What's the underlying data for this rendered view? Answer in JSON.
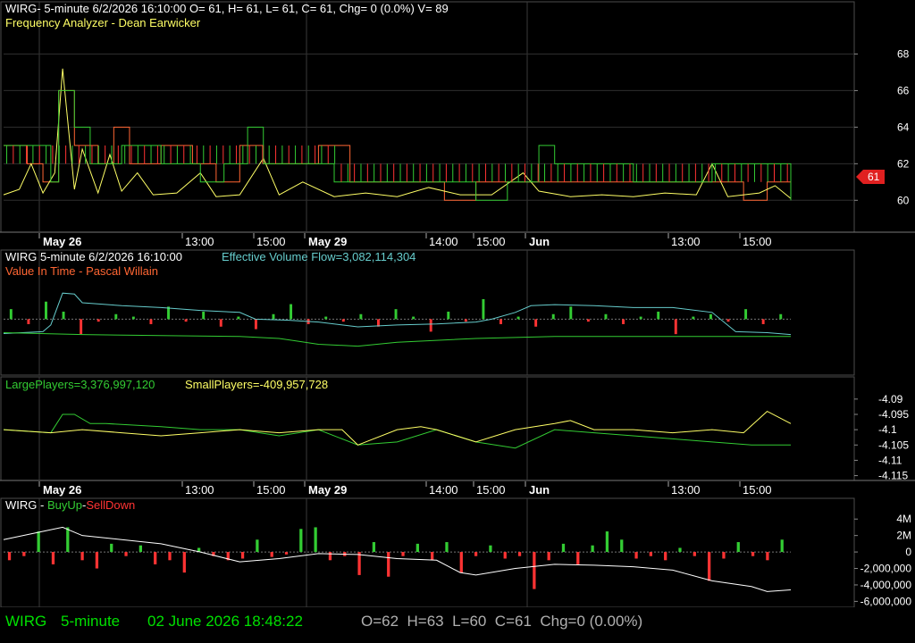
{
  "colors": {
    "background": "#000000",
    "border": "#4d4d4d",
    "grid": "#2e2e2e",
    "text": "#ffffff",
    "orange": "#ff6633",
    "yellow": "#ffff66",
    "green": "#33cc33",
    "red": "#ff3333",
    "teal": "#66cccc",
    "footer_green": "#00e000",
    "footer_grey": "#b0b0b0"
  },
  "header": {
    "line1": "WIRG- 5-minute 6/2/2026 16:10:00 O= 61, H= 61, L= 61, C= 61, Chg= 0 (0.0%) V= 89",
    "line2": "Frequency Analyzer - Dean Earwicker"
  },
  "time_axis": {
    "date_labels": [
      "May 26",
      "May 29",
      "Jun"
    ],
    "time_labels": [
      "13:00",
      "15:00",
      "14:00",
      "15:00",
      "13:00",
      "15:00"
    ]
  },
  "panel2": {
    "title": "WIRG 5-minute  6/2/2026 16:10:00",
    "evf_label": "Effective Volume Flow=3,082,114,304",
    "subtitle": "Value In Time - Pascal Willain"
  },
  "panel3": {
    "large_label": "LargePlayers=3,376,997,120",
    "small_label": "SmallPlayers=-409,957,728"
  },
  "panel4": {
    "title_prefix": "WIRG - ",
    "buyup": "BuyUp",
    "dash": "-",
    "selldown": "SellDown"
  },
  "footer": {
    "symbol": "WIRG",
    "interval": "5-minute",
    "datetime": "02 June 2026 18:48:22",
    "ohlc": "O=62  H=63  L=60  C=61  Chg=0 (0.00%)"
  },
  "chart_data": [
    {
      "type": "line",
      "name": "price-panel",
      "ylim": [
        58.5,
        69
      ],
      "y_ticks": [
        "68",
        "66",
        "64",
        "62",
        "60"
      ],
      "last_value_label": "61",
      "last_value": 61,
      "series": [
        {
          "name": "",
          "color": "orange",
          "style": "step",
          "points": [
            [
              0,
              63
            ],
            [
              0.03,
              62
            ],
            [
              0.05,
              61
            ],
            [
              0.07,
              66
            ],
            [
              0.09,
              63
            ],
            [
              0.12,
              62
            ],
            [
              0.14,
              64
            ],
            [
              0.16,
              62
            ],
            [
              0.2,
              63
            ],
            [
              0.24,
              62
            ],
            [
              0.27,
              61
            ],
            [
              0.3,
              63
            ],
            [
              0.33,
              62
            ],
            [
              0.36,
              62
            ],
            [
              0.4,
              63
            ],
            [
              0.44,
              61
            ],
            [
              0.48,
              61
            ],
            [
              0.52,
              61
            ],
            [
              0.56,
              60
            ],
            [
              0.6,
              61
            ],
            [
              0.63,
              61
            ],
            [
              0.67,
              61
            ],
            [
              0.7,
              61
            ],
            [
              0.74,
              61
            ],
            [
              0.78,
              61
            ],
            [
              0.82,
              61
            ],
            [
              0.86,
              61
            ],
            [
              0.9,
              61
            ],
            [
              0.94,
              60
            ],
            [
              0.97,
              61
            ],
            [
              1.0,
              61
            ]
          ]
        },
        {
          "name": "",
          "color": "yellow",
          "style": "line",
          "points": [
            [
              0,
              60.3
            ],
            [
              0.02,
              60.6
            ],
            [
              0.035,
              62
            ],
            [
              0.05,
              60.4
            ],
            [
              0.065,
              61.5
            ],
            [
              0.075,
              67.2
            ],
            [
              0.09,
              60.6
            ],
            [
              0.1,
              62.8
            ],
            [
              0.12,
              60.4
            ],
            [
              0.135,
              62.5
            ],
            [
              0.15,
              60.5
            ],
            [
              0.17,
              61.5
            ],
            [
              0.19,
              60.3
            ],
            [
              0.22,
              60.4
            ],
            [
              0.25,
              61.5
            ],
            [
              0.27,
              60.2
            ],
            [
              0.3,
              60.3
            ],
            [
              0.33,
              62.3
            ],
            [
              0.35,
              60.3
            ],
            [
              0.38,
              61
            ],
            [
              0.42,
              60.2
            ],
            [
              0.46,
              60.4
            ],
            [
              0.5,
              60.2
            ],
            [
              0.54,
              60.7
            ],
            [
              0.58,
              60.3
            ],
            [
              0.62,
              60.3
            ],
            [
              0.66,
              61.5
            ],
            [
              0.68,
              60.5
            ],
            [
              0.72,
              60.2
            ],
            [
              0.76,
              60.3
            ],
            [
              0.8,
              60.2
            ],
            [
              0.84,
              60.4
            ],
            [
              0.88,
              60.3
            ],
            [
              0.9,
              62
            ],
            [
              0.92,
              60.2
            ],
            [
              0.96,
              60.4
            ],
            [
              0.98,
              60.8
            ],
            [
              1.0,
              60.1
            ]
          ]
        },
        {
          "name": "",
          "color": "green",
          "style": "step",
          "points": [
            [
              0,
              63
            ],
            [
              0.06,
              61
            ],
            [
              0.07,
              66
            ],
            [
              0.09,
              64
            ],
            [
              0.11,
              62
            ],
            [
              0.15,
              63
            ],
            [
              0.2,
              62
            ],
            [
              0.25,
              61
            ],
            [
              0.28,
              62
            ],
            [
              0.31,
              64
            ],
            [
              0.33,
              62
            ],
            [
              0.38,
              62
            ],
            [
              0.42,
              61
            ],
            [
              0.45,
              61
            ],
            [
              0.5,
              61
            ],
            [
              0.55,
              61
            ],
            [
              0.6,
              60
            ],
            [
              0.64,
              61
            ],
            [
              0.68,
              63
            ],
            [
              0.7,
              62
            ],
            [
              0.74,
              62
            ],
            [
              0.8,
              61
            ],
            [
              0.86,
              61
            ],
            [
              0.9,
              62
            ],
            [
              0.95,
              62
            ],
            [
              0.98,
              62
            ],
            [
              1.0,
              60
            ]
          ]
        }
      ]
    },
    {
      "type": "line",
      "name": "value-in-time-panel",
      "series": [
        {
          "name": "",
          "color": "teal",
          "style": "line",
          "points": [
            [
              0,
              0.57
            ],
            [
              0.05,
              0.55
            ],
            [
              0.06,
              0.48
            ],
            [
              0.075,
              0.15
            ],
            [
              0.09,
              0.16
            ],
            [
              0.1,
              0.25
            ],
            [
              0.15,
              0.28
            ],
            [
              0.2,
              0.3
            ],
            [
              0.25,
              0.33
            ],
            [
              0.3,
              0.35
            ],
            [
              0.32,
              0.42
            ],
            [
              0.36,
              0.43
            ],
            [
              0.4,
              0.45
            ],
            [
              0.45,
              0.5
            ],
            [
              0.5,
              0.48
            ],
            [
              0.55,
              0.47
            ],
            [
              0.6,
              0.45
            ],
            [
              0.62,
              0.42
            ],
            [
              0.65,
              0.35
            ],
            [
              0.67,
              0.28
            ],
            [
              0.7,
              0.27
            ],
            [
              0.75,
              0.28
            ],
            [
              0.8,
              0.3
            ],
            [
              0.85,
              0.3
            ],
            [
              0.9,
              0.35
            ],
            [
              0.93,
              0.55
            ],
            [
              0.97,
              0.56
            ],
            [
              1.0,
              0.58
            ]
          ]
        },
        {
          "name": "",
          "color": "green",
          "style": "line",
          "points": [
            [
              0,
              0.56
            ],
            [
              0.1,
              0.58
            ],
            [
              0.3,
              0.6
            ],
            [
              0.35,
              0.62
            ],
            [
              0.4,
              0.68
            ],
            [
              0.45,
              0.7
            ],
            [
              0.5,
              0.66
            ],
            [
              0.55,
              0.64
            ],
            [
              0.6,
              0.62
            ],
            [
              0.65,
              0.61
            ],
            [
              0.7,
              0.6
            ],
            [
              0.8,
              0.6
            ],
            [
              0.9,
              0.6
            ],
            [
              1.0,
              0.6
            ]
          ]
        }
      ],
      "bars": [
        0.4,
        -0.2,
        0.7,
        0.3,
        -0.6,
        -0.1,
        0.2,
        0.1,
        -0.2,
        0.5,
        -0.1,
        0.3,
        -0.3,
        0.1,
        -0.4,
        0.2,
        0.6,
        -0.2,
        0.1,
        -0.1,
        0.2,
        -0.3,
        0.4,
        0.1,
        -0.5,
        0.3,
        -0.1,
        0.8,
        -0.2,
        0.1,
        -0.3,
        0.2,
        0.5,
        -0.1,
        0.2,
        -0.2,
        0.1,
        0.3,
        -0.6,
        0.1,
        0.2,
        -0.1,
        0.4,
        -0.2,
        0.2
      ]
    },
    {
      "type": "line",
      "name": "players-panel",
      "ylim": [
        -4.116,
        -4.088
      ],
      "y_ticks": [
        "-4.09",
        "-4.095",
        "-4.1",
        "-4.105",
        "-4.11",
        "-4.115"
      ],
      "series": [
        {
          "name": "LargePlayers",
          "color": "green",
          "style": "line",
          "points": [
            [
              0,
              -4.1
            ],
            [
              0.06,
              -4.101
            ],
            [
              0.075,
              -4.095
            ],
            [
              0.09,
              -4.095
            ],
            [
              0.11,
              -4.098
            ],
            [
              0.13,
              -4.098
            ],
            [
              0.2,
              -4.099
            ],
            [
              0.25,
              -4.1
            ],
            [
              0.3,
              -4.1
            ],
            [
              0.35,
              -4.102
            ],
            [
              0.4,
              -4.1
            ],
            [
              0.45,
              -4.105
            ],
            [
              0.5,
              -4.104
            ],
            [
              0.55,
              -4.1
            ],
            [
              0.6,
              -4.104
            ],
            [
              0.65,
              -4.106
            ],
            [
              0.7,
              -4.1
            ],
            [
              0.75,
              -4.101
            ],
            [
              0.8,
              -4.102
            ],
            [
              0.85,
              -4.103
            ],
            [
              0.9,
              -4.104
            ],
            [
              0.95,
              -4.105
            ],
            [
              1.0,
              -4.105
            ]
          ]
        },
        {
          "name": "SmallPlayers",
          "color": "yellow",
          "style": "line",
          "points": [
            [
              0,
              -4.1
            ],
            [
              0.06,
              -4.101
            ],
            [
              0.1,
              -4.1
            ],
            [
              0.15,
              -4.101
            ],
            [
              0.2,
              -4.102
            ],
            [
              0.25,
              -4.101
            ],
            [
              0.3,
              -4.1
            ],
            [
              0.35,
              -4.101
            ],
            [
              0.4,
              -4.1
            ],
            [
              0.43,
              -4.1
            ],
            [
              0.45,
              -4.105
            ],
            [
              0.5,
              -4.1
            ],
            [
              0.53,
              -4.099
            ],
            [
              0.55,
              -4.1
            ],
            [
              0.6,
              -4.104
            ],
            [
              0.65,
              -4.1
            ],
            [
              0.7,
              -4.098
            ],
            [
              0.72,
              -4.097
            ],
            [
              0.75,
              -4.1
            ],
            [
              0.8,
              -4.1
            ],
            [
              0.85,
              -4.101
            ],
            [
              0.9,
              -4.1
            ],
            [
              0.94,
              -4.101
            ],
            [
              0.97,
              -4.094
            ],
            [
              1.0,
              -4.098
            ]
          ]
        }
      ]
    },
    {
      "type": "bar",
      "name": "buyup-selldown-panel",
      "ylim": [
        -6500000,
        5000000
      ],
      "y_ticks": [
        "4M",
        "2M",
        "0",
        "-2,000,000",
        "-4,000,000",
        "-6,000,000"
      ],
      "y_tick_values": [
        4000000,
        2000000,
        0,
        -2000000,
        -4000000,
        -6000000
      ],
      "bars": [
        -1000000,
        -500000,
        2500000,
        -1500000,
        3000000,
        -1000000,
        -2000000,
        1000000,
        -500000,
        800000,
        -1500000,
        -1000000,
        -2500000,
        500000,
        -500000,
        -1000000,
        -800000,
        1500000,
        -600000,
        -300000,
        2800000,
        3000000,
        -1000000,
        -500000,
        -2800000,
        1200000,
        -3000000,
        -500000,
        1000000,
        -1000000,
        1200000,
        -2500000,
        -500000,
        800000,
        -800000,
        -500000,
        -4500000,
        -1000000,
        1000000,
        -1500000,
        800000,
        2500000,
        1500000,
        -800000,
        -500000,
        -1000000,
        500000,
        -500000,
        -3500000,
        -800000,
        1200000,
        -500000,
        -1000000,
        1500000
      ],
      "series": [
        {
          "name": "",
          "color": "white",
          "style": "line",
          "points": [
            [
              0,
              1500000
            ],
            [
              0.05,
              2500000
            ],
            [
              0.075,
              3000000
            ],
            [
              0.1,
              2000000
            ],
            [
              0.15,
              1500000
            ],
            [
              0.2,
              1000000
            ],
            [
              0.25,
              0
            ],
            [
              0.3,
              -1200000
            ],
            [
              0.35,
              -800000
            ],
            [
              0.4,
              -200000
            ],
            [
              0.45,
              -300000
            ],
            [
              0.5,
              -800000
            ],
            [
              0.55,
              -1000000
            ],
            [
              0.58,
              -2500000
            ],
            [
              0.6,
              -2800000
            ],
            [
              0.65,
              -2000000
            ],
            [
              0.7,
              -1500000
            ],
            [
              0.75,
              -1600000
            ],
            [
              0.8,
              -1800000
            ],
            [
              0.85,
              -2200000
            ],
            [
              0.9,
              -3500000
            ],
            [
              0.95,
              -4200000
            ],
            [
              0.97,
              -4800000
            ],
            [
              1.0,
              -4600000
            ]
          ]
        }
      ]
    }
  ]
}
